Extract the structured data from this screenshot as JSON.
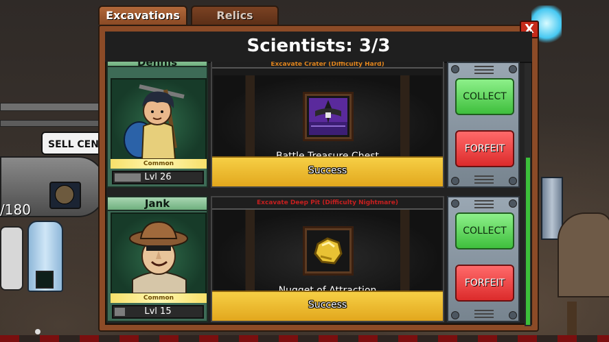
{
  "tabs": [
    {
      "label": "Excavations",
      "active": true
    },
    {
      "label": "Relics",
      "active": false
    }
  ],
  "close_label": "X",
  "header": {
    "title": "Scientists: 3/3"
  },
  "background": {
    "sell_sign": "SELL CENT",
    "counter": "/180"
  },
  "rows": [
    {
      "scientist": {
        "name": "Dennis",
        "rarity": "Common",
        "level": "Lvl 26",
        "level_fill": 0.3
      },
      "excavation": {
        "title": "Excavate Crater (Difficulty Hard)",
        "difficulty_color": "#e0841d",
        "item": "Battle Treasure Chest",
        "status": "Success"
      },
      "actions": {
        "collect": "COLLECT",
        "forfeit": "FORFEIT"
      }
    },
    {
      "scientist": {
        "name": "Jank",
        "rarity": "Common",
        "level": "Lvl 15",
        "level_fill": 0.12
      },
      "excavation": {
        "title": "Excavate Deep Pit (Difficulty Nightmare)",
        "difficulty_color": "#c81f1f",
        "item": "Nugget of Attraction",
        "status": "Success"
      },
      "actions": {
        "collect": "COLLECT",
        "forfeit": "FORFEIT"
      }
    }
  ],
  "colors": {
    "collect": "#3fbf3d",
    "forfeit": "#dc2b2b",
    "status": "#f6cf45",
    "scroll": "#3cbf3a"
  }
}
